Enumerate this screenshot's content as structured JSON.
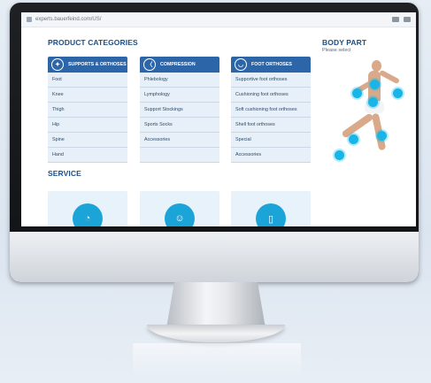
{
  "browser": {
    "url": "experts.bauerfeind.com/US/"
  },
  "headings": {
    "product_categories": "PRODUCT CATEGORIES",
    "body_part": "BODY PART",
    "body_part_sub": "Please select",
    "service": "SERVICE"
  },
  "categories": [
    {
      "title": "SUPPORTS & ORTHOSES",
      "icon": "knee-support-icon",
      "items": [
        "Foot",
        "Knee",
        "Thigh",
        "Hip",
        "Spine",
        "Hand"
      ]
    },
    {
      "title": "COMPRESSION",
      "icon": "leg-compression-icon",
      "items": [
        "Phlebology",
        "Lymphology",
        "Support Stockings",
        "Sports Socks",
        "Accessories"
      ]
    },
    {
      "title": "FOOT ORTHOSES",
      "icon": "foot-insole-icon",
      "items": [
        "Supportive foot orthoses",
        "Cushioning foot orthoses",
        "Soft cushioning foot orthoses",
        "Shell foot orthoses",
        "Special",
        "Accessories"
      ]
    }
  ],
  "service_cards": [
    {
      "icon": "ear-icon"
    },
    {
      "icon": "person-icon"
    },
    {
      "icon": "phone-icon"
    }
  ],
  "colors": {
    "brand_blue": "#2d66a8",
    "accent_cyan": "#17b5e8",
    "heading_blue": "#1d4f86"
  }
}
